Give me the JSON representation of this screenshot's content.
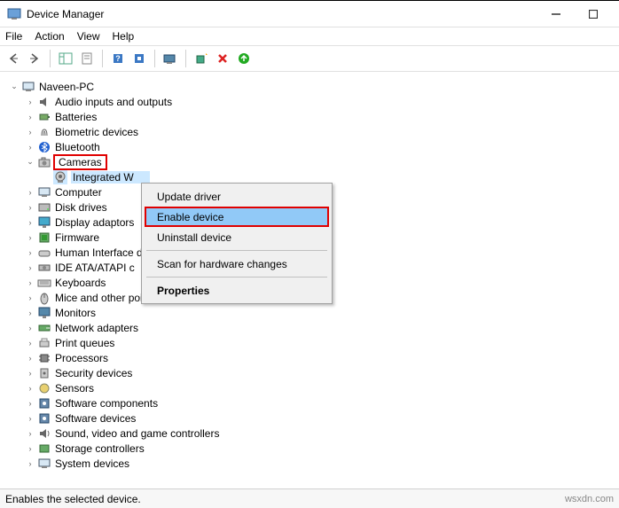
{
  "title": "Device Manager",
  "menu": {
    "file": "File",
    "action": "Action",
    "view": "View",
    "help": "Help"
  },
  "root": "Naveen-PC",
  "categories": [
    {
      "label": "Audio inputs and outputs"
    },
    {
      "label": "Batteries"
    },
    {
      "label": "Biometric devices"
    },
    {
      "label": "Bluetooth"
    },
    {
      "label": "Cameras",
      "highlight": true,
      "expanded": true,
      "child": "Integrated W"
    },
    {
      "label": "Computer"
    },
    {
      "label": "Disk drives"
    },
    {
      "label": "Display adaptors"
    },
    {
      "label": "Firmware"
    },
    {
      "label": "Human Interface d"
    },
    {
      "label": "IDE ATA/ATAPI c"
    },
    {
      "label": "Keyboards"
    },
    {
      "label": "Mice and other pointing devices"
    },
    {
      "label": "Monitors"
    },
    {
      "label": "Network adapters"
    },
    {
      "label": "Print queues"
    },
    {
      "label": "Processors"
    },
    {
      "label": "Security devices"
    },
    {
      "label": "Sensors"
    },
    {
      "label": "Software components"
    },
    {
      "label": "Software devices"
    },
    {
      "label": "Sound, video and game controllers"
    },
    {
      "label": "Storage controllers"
    },
    {
      "label": "System devices"
    }
  ],
  "context": {
    "update": "Update driver",
    "enable": "Enable device",
    "uninstall": "Uninstall device",
    "scan": "Scan for hardware changes",
    "properties": "Properties"
  },
  "status": "Enables the selected device.",
  "watermark": "wsxdn.com"
}
